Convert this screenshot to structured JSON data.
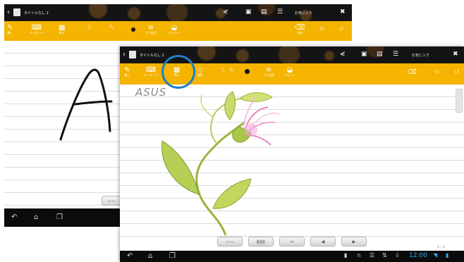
{
  "back_screen": {
    "title": "タイトルなし 2",
    "status_pill": "お気に入り",
    "nav_button_label": "ーー",
    "toolbar": [
      {
        "label": "書く",
        "icon": "✎"
      },
      {
        "label": "キーボード",
        "icon": "⌨"
      },
      {
        "label": "挿入",
        "icon": "▦"
      },
      {
        "label": "",
        "icon": "⇧"
      },
      {
        "label": "",
        "icon": "✎"
      },
      {
        "label": "ペン設定",
        "icon": "≡"
      },
      {
        "label": "パレット",
        "icon": "◒"
      }
    ],
    "right_tools": [
      {
        "label": "消去",
        "icon": "⌫"
      }
    ]
  },
  "front_screen": {
    "title": "タイトルなし 2",
    "status_pill": "お気に入り",
    "handwritten_text": "ASUS",
    "page_indicator": "1 / 1",
    "clock": "12:00",
    "toolbar": [
      {
        "label": "書く",
        "icon": "✎"
      },
      {
        "label": "キーボード",
        "icon": "⌨"
      },
      {
        "label": "挿入",
        "icon": "▦"
      },
      {
        "label": "図形",
        "icon": "◇"
      },
      {
        "label": "",
        "icon": "⇧"
      },
      {
        "label": "",
        "icon": "✎"
      },
      {
        "label": "ペン設定",
        "icon": "≡"
      },
      {
        "label": "パレット",
        "icon": "◒"
      }
    ],
    "bottom_buttons": [
      {
        "label": "ーー"
      },
      {
        "label": "削除"
      },
      {
        "label": "↵"
      },
      {
        "label": "◀"
      },
      {
        "label": "▶"
      }
    ]
  },
  "icons": {
    "share": "share-icon",
    "layout": "layout-icon",
    "menu": "menu-icon",
    "back_arrow": "back-arrow-icon",
    "home": "home-icon",
    "recent": "recent-apps-icon"
  },
  "colors": {
    "toolbar": "#f4b400",
    "titlebar": "#141414",
    "highlight": "#1f7ec8"
  }
}
